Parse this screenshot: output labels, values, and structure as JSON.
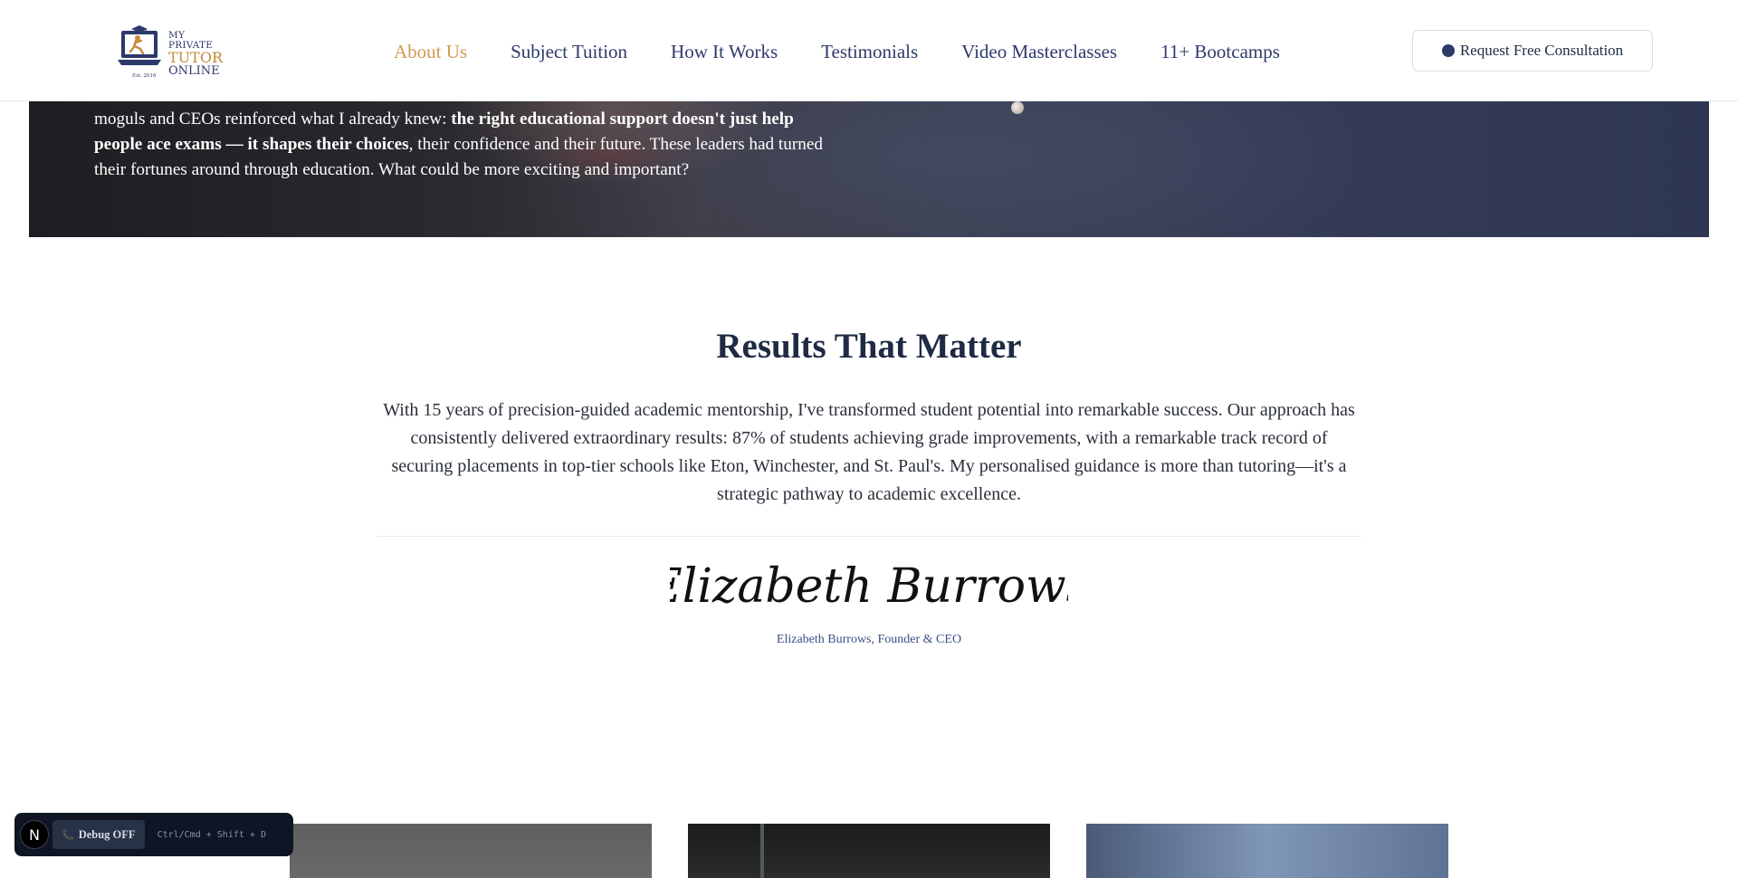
{
  "header": {
    "logo": {
      "line1": "MY PRIVATE",
      "line2": "TUTOR",
      "line3": "ONLINE",
      "est": "Est. 2016"
    },
    "nav": [
      {
        "label": "About Us",
        "active": true
      },
      {
        "label": "Subject Tuition",
        "active": false
      },
      {
        "label": "How It Works",
        "active": false
      },
      {
        "label": "Testimonials",
        "active": false
      },
      {
        "label": "Video Masterclasses",
        "active": false
      },
      {
        "label": "11+ Bootcamps",
        "active": false
      }
    ],
    "cta_label": "Request Free Consultation"
  },
  "hero": {
    "text_before": "moguls and CEOs reinforced what I already knew: ",
    "text_bold": "the right educational support doesn't just help people ace exams — it shapes their choices",
    "text_after": ", their confidence and their future. These leaders had turned their fortunes around through education. What could be more exciting and important?"
  },
  "results": {
    "title": "Results That Matter",
    "body": "With 15 years of precision-guided academic mentorship, I've transformed student potential into remarkable success. Our approach has consistently delivered extraordinary results: 87% of students achieving grade improvements, with a remarkable track record of securing placements in top-tier schools like Eton, Winchester, and St. Paul's. My personalised guidance is more than tutoring—it's a strategic pathway to academic excellence.",
    "signature": "Elizabeth Burrows",
    "caption": "Elizabeth Burrows, Founder & CEO"
  },
  "debug": {
    "logo_letter": "N",
    "toggle_label": "Debug OFF",
    "shortcut": "Ctrl/Cmd + Shift + D"
  },
  "colors": {
    "brand_navy": "#2d3a6a",
    "brand_gold": "#d19a50",
    "caption_blue": "#3d4f8a"
  },
  "icons": {
    "cta": "dot-icon",
    "debug_toggle": "phone-icon"
  }
}
